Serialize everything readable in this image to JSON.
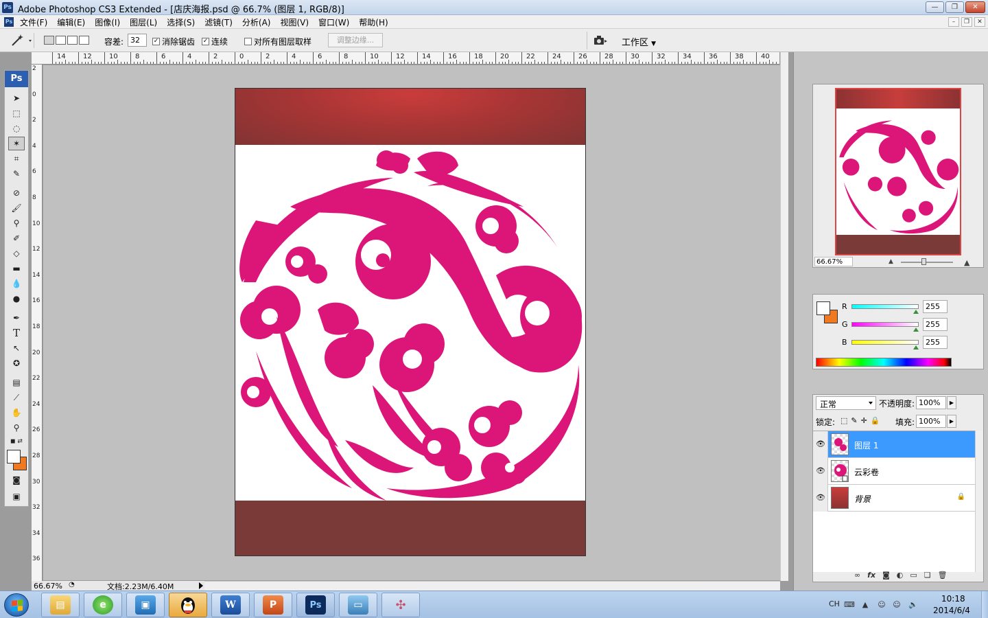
{
  "window": {
    "title": "Adobe Photoshop CS3 Extended - [店庆海报.psd @ 66.7% (图层 1, RGB/8)]",
    "app_icon_label": "Ps",
    "min_label": "—",
    "max_label": "❐",
    "close_label": "✕"
  },
  "menu": {
    "items": [
      "文件(F)",
      "编辑(E)",
      "图像(I)",
      "图层(L)",
      "选择(S)",
      "滤镜(T)",
      "分析(A)",
      "视图(V)",
      "窗口(W)",
      "帮助(H)"
    ],
    "doc_min": "–",
    "doc_restore": "❐",
    "doc_close": "✕"
  },
  "options": {
    "tolerance_label": "容差:",
    "tolerance_value": "32",
    "antialias_label": "消除锯齿",
    "antialias_checked": true,
    "contiguous_label": "连续",
    "contiguous_checked": true,
    "sample_all_label": "对所有图层取样",
    "sample_all_checked": false,
    "refine_edge_label": "调整边缘...",
    "workspace_label": "工作区"
  },
  "toolbox": {
    "header": "Ps"
  },
  "ruler_top": {
    "labels": [
      "14",
      "12",
      "10",
      "8",
      "6",
      "4",
      "2",
      "0",
      "2",
      "4",
      "6",
      "8",
      "10",
      "12",
      "14",
      "16",
      "18",
      "20",
      "22",
      "24",
      "26",
      "28",
      "30",
      "32",
      "34",
      "36",
      "38",
      "40"
    ]
  },
  "ruler_left": {
    "labels": [
      "2",
      "0",
      "2",
      "4",
      "6",
      "8",
      "10",
      "12",
      "14",
      "16",
      "18",
      "20",
      "22",
      "24",
      "26",
      "28",
      "30",
      "32",
      "34",
      "36"
    ]
  },
  "status": {
    "zoom": "66.67%",
    "doc_info": "文档:2.23M/6.40M"
  },
  "navigator": {
    "zoom": "66.67%"
  },
  "color_panel": {
    "foreground": "#ffffff",
    "background": "#f07a22",
    "channels": [
      {
        "label": "R",
        "value": "255",
        "gradient": "linear-gradient(90deg,#00ffff,#ffffff)"
      },
      {
        "label": "G",
        "value": "255",
        "gradient": "linear-gradient(90deg,#ff00ff,#ffffff)"
      },
      {
        "label": "B",
        "value": "255",
        "gradient": "linear-gradient(90deg,#ffff00,#ffffff)"
      }
    ]
  },
  "layers_panel": {
    "blend_mode": "正常",
    "opacity_label": "不透明度:",
    "opacity_value": "100%",
    "lock_label": "锁定:",
    "fill_label": "填充:",
    "fill_value": "100%",
    "layers": [
      {
        "name": "图层 1",
        "selected": true
      },
      {
        "name": "云彩卷",
        "selected": false
      },
      {
        "name": "背景",
        "selected": false,
        "locked": true
      }
    ]
  },
  "taskbar": {
    "apps": [
      "file-explorer",
      "360-browser",
      "app-manager",
      "qq",
      "word",
      "powerpoint",
      "photoshop",
      "photo-viewer",
      "paint-app"
    ],
    "lang": "CH",
    "time": "10:18",
    "date": "2014/6/4"
  },
  "colors": {
    "accent_magenta": "#dc1579",
    "band_red": "#a83535",
    "band_dark": "#7a3a37",
    "selection_blue": "#3c9aff"
  }
}
